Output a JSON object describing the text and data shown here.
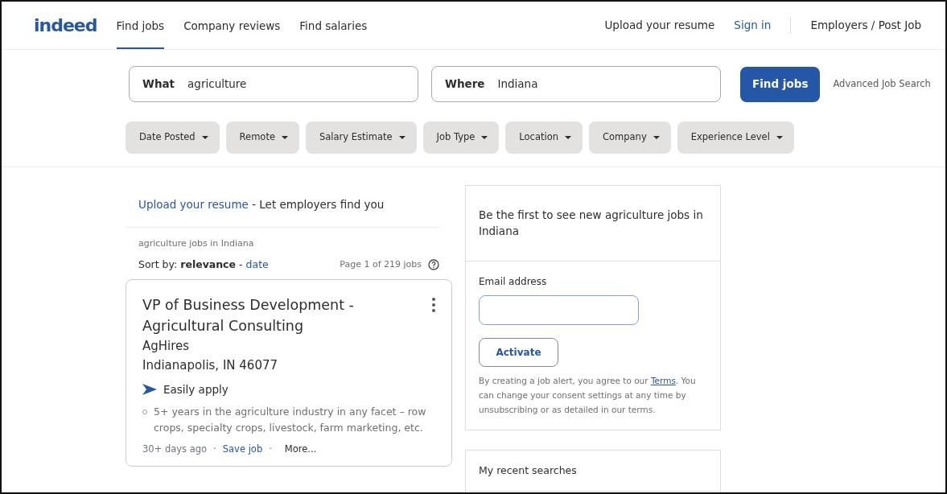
{
  "header": {
    "logo": "indeed",
    "nav": [
      {
        "label": "Find jobs",
        "selected": true
      },
      {
        "label": "Company reviews",
        "selected": false
      },
      {
        "label": "Find salaries",
        "selected": false
      }
    ],
    "right_links": [
      {
        "label": "Upload your resume",
        "kind": "plain"
      },
      {
        "label": "Sign in",
        "kind": "accent"
      },
      {
        "label": "Employers / Post Job",
        "kind": "divided"
      }
    ]
  },
  "search": {
    "what": {
      "label": "What",
      "value": "agriculture"
    },
    "where": {
      "label": "Where",
      "value": "Indiana"
    },
    "button": "Find jobs",
    "advanced": "Advanced Job Search"
  },
  "filters": [
    "Date Posted",
    "Remote",
    "Salary Estimate",
    "Job Type",
    "Location",
    "Company",
    "Experience Level"
  ],
  "results": {
    "upload_prompt": {
      "link": "Upload your resume",
      "text": "- Let employers find you"
    },
    "query": "agriculture jobs in Indiana",
    "sort": {
      "label": "Sort by:",
      "separator": "-",
      "options": [
        {
          "label": "relevance",
          "selected": true
        },
        {
          "label": "date",
          "selected": false
        }
      ]
    },
    "page_count": "Page 1 of 219 jobs",
    "jobs": [
      {
        "title": "VP of Business Development - Agricultural Consulting",
        "company": "AgHires",
        "location": "Indianapolis, IN 46077",
        "easily_apply": "Easily apply",
        "snippet": "5+ years in the agriculture industry in any facet – row crops, specialty crops, livestock, farm marketing, etc.",
        "age": "30+ days ago",
        "separator": "·",
        "save": "Save job",
        "more": "More..."
      }
    ]
  },
  "alert": {
    "title": "Be the first to see new agriculture jobs in Indiana",
    "email_label": "Email address",
    "button": "Activate",
    "legal": {
      "before": "By creating a job alert, you agree to our",
      "link": "Terms",
      "after": ". You can change your consent settings at any time by unsubscribing or as detailed in our terms."
    }
  },
  "recent": {
    "title": "My recent searches"
  }
}
